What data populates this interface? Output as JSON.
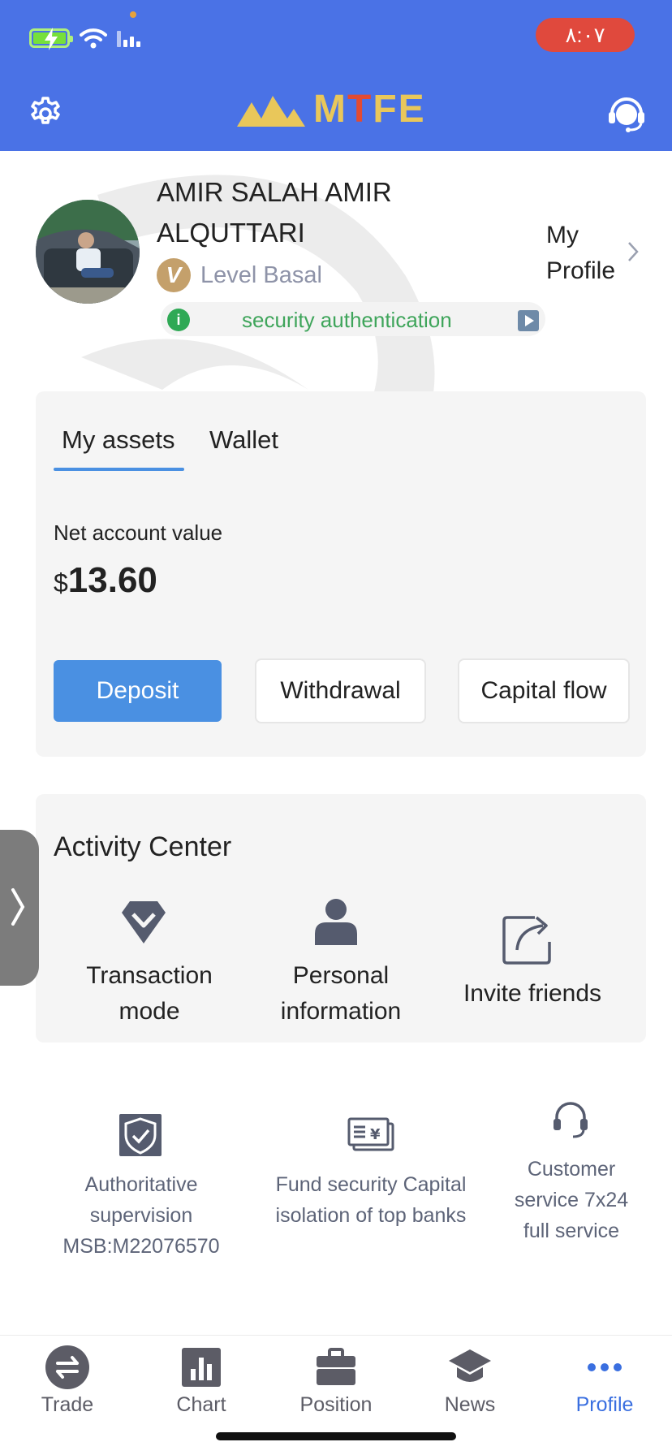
{
  "status": {
    "time": "٨:٠٧"
  },
  "header": {
    "logo_text_m": "M",
    "logo_text_t": "T",
    "logo_text_fe": "FE"
  },
  "profile": {
    "name": "AMIR SALAH AMIR ALQUTTARI",
    "level_badge": "V",
    "level": "Level Basal",
    "security": "security authentication",
    "my_profile": "My Profile"
  },
  "assets": {
    "tabs": [
      "My assets",
      "Wallet"
    ],
    "active_tab": "My assets",
    "net_label": "Net account value",
    "currency": "$",
    "net_value": "13.60",
    "buttons": {
      "deposit": "Deposit",
      "withdrawal": "Withdrawal",
      "capital_flow": "Capital flow"
    }
  },
  "activity": {
    "title": "Activity Center",
    "items": [
      {
        "label": "Transaction mode",
        "icon": "diamond-icon"
      },
      {
        "label": "Personal information",
        "icon": "person-icon"
      },
      {
        "label": "Invite friends",
        "icon": "share-icon"
      }
    ]
  },
  "features": [
    {
      "text": "Authoritative supervision MSB:M22076570",
      "icon": "shield-check-icon"
    },
    {
      "text": "Fund security Capital isolation of top banks",
      "icon": "bank-card-icon"
    },
    {
      "text": "Customer service 7x24 full service",
      "icon": "headset-icon"
    }
  ],
  "nav": {
    "items": [
      {
        "label": "Trade",
        "icon": "trade-icon"
      },
      {
        "label": "Chart",
        "icon": "chart-icon"
      },
      {
        "label": "Position",
        "icon": "briefcase-icon"
      },
      {
        "label": "News",
        "icon": "graduation-cap-icon"
      },
      {
        "label": "Profile",
        "icon": "more-dots-icon"
      }
    ],
    "active": "Profile"
  },
  "colors": {
    "header": "#4a72e6",
    "accent": "#4a90e2",
    "active_nav": "#3a6fe0",
    "secure_green": "#3fa55b"
  }
}
